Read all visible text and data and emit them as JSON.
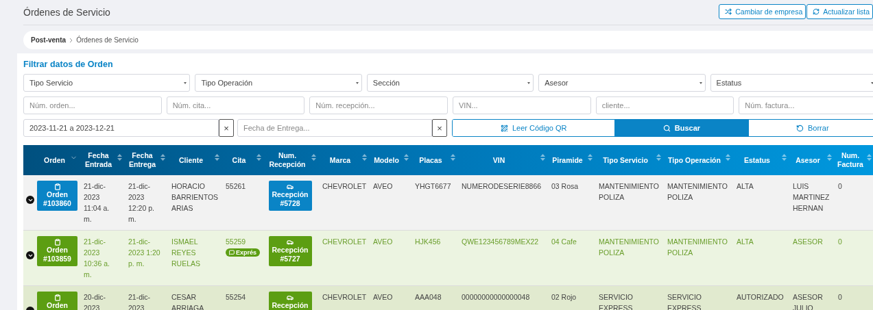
{
  "page_title": "Órdenes de Servicio",
  "header_buttons": [
    {
      "kind": "shuffle",
      "label": "Cambiar de empresa"
    },
    {
      "kind": "refresh",
      "label": "Actualizar lista"
    }
  ],
  "breadcrumb": [
    "Post-venta",
    "Órdenes de Servicio"
  ],
  "filter": {
    "title": "Filtrar datos de Orden",
    "selects": [
      "Tipo Servicio",
      "Tipo Operación",
      "Sección",
      "Asesor",
      "Estatus"
    ],
    "text_fields": [
      {
        "placeholder": "Núm. orden..."
      },
      {
        "placeholder": "Núm. cita..."
      },
      {
        "placeholder": "Núm. recepción..."
      },
      {
        "placeholder": "VIN..."
      },
      {
        "placeholder": "cliente..."
      },
      {
        "placeholder": "Núm. factura..."
      }
    ],
    "date_range": {
      "value": "2023-11-21 a 2023-12-21",
      "clear": "×"
    },
    "delivery_date": {
      "placeholder": "Fecha de Entrega...",
      "clear": "×"
    },
    "actions": [
      {
        "kind": "qr",
        "label": "Leer Código QR",
        "primary": false
      },
      {
        "kind": "search",
        "label": "Buscar",
        "primary": true
      },
      {
        "kind": "reset",
        "label": "Borrar",
        "primary": false
      }
    ]
  },
  "table": {
    "columns": [
      {
        "label": "Orden",
        "sorted": true
      },
      {
        "label": "Fecha Entrada",
        "sorted": false
      },
      {
        "label": "Fecha Entrega",
        "sorted": false
      },
      {
        "label": "Cliente",
        "sorted": false
      },
      {
        "label": "Cita",
        "sorted": false
      },
      {
        "label": "Num. Recepción",
        "sorted": false
      },
      {
        "label": "Marca",
        "sorted": false
      },
      {
        "label": "Modelo",
        "sorted": false
      },
      {
        "label": "Placas",
        "sorted": false
      },
      {
        "label": "VIN",
        "sorted": false
      },
      {
        "label": "Piramide",
        "sorted": false
      },
      {
        "label": "Tipo Servicio",
        "sorted": false
      },
      {
        "label": "Tipo Operación",
        "sorted": false
      },
      {
        "label": "Estatus",
        "sorted": false
      },
      {
        "label": "Asesor",
        "sorted": false
      },
      {
        "label": "Num. Factura",
        "sorted": false
      }
    ],
    "rows": [
      {
        "kind": "normal",
        "hovered": false,
        "order_label": "Orden",
        "order_number": "#103860",
        "entry_date": "21-dic-2023 11:04 a. m.",
        "delivery_date": "21-dic-2023 12:20 p. m.",
        "client": "HORACIO BARRIENTOS ARIAS",
        "appointment": "55261",
        "reception_label": "Recepción",
        "reception_number": "#5728",
        "brand": "CHEVROLET",
        "model": "AVEO",
        "plates": "YHGT6677",
        "vin": "NUMERODESERIE8866",
        "pyramid": "03 Rosa",
        "service_type": "MANTENIMIENTO POLIZA",
        "operation_type": "MANTENIMIENTO POLIZA",
        "status": "ALTA",
        "advisor": "LUIS MARTINEZ HERNAN",
        "invoice": "0"
      },
      {
        "kind": "express",
        "hovered": false,
        "order_label": "Orden",
        "order_number": "#103859",
        "entry_date": "21-dic-2023 10:36 a. m.",
        "delivery_date": "21-dic-2023 1:20 p. m.",
        "client": "ISMAEL REYES RUELAS",
        "appointment": "55259",
        "badge": "Exprés",
        "reception_label": "Recepción",
        "reception_number": "#5727",
        "brand": "CHEVROLET",
        "model": "AVEO",
        "plates": "HJK456",
        "vin": "QWE123456789MEX22",
        "pyramid": "04 Cafe",
        "service_type": "MANTENIMIENTO POLIZA",
        "operation_type": "MANTENIMIENTO POLIZA",
        "status": "ALTA",
        "advisor": "ASESOR",
        "invoice": "0"
      },
      {
        "kind": "express",
        "hovered": true,
        "order_label": "Orden",
        "entry_date": "20-dic-2023",
        "delivery_date": "21-dic-2023",
        "client": "CESAR ARRIAGA",
        "appointment": "55254",
        "reception_label": "Recepción",
        "brand": "CHEVROLET",
        "model": "AVEO",
        "plates": "AAA048",
        "vin": "00000000000000048",
        "pyramid": "02 Rojo",
        "service_type": "SERVICIO EXPRESS",
        "operation_type": "SERVICIO EXPRESS",
        "status": "AUTORIZADO",
        "advisor": "ASESOR JULIO",
        "invoice": "0"
      }
    ]
  }
}
